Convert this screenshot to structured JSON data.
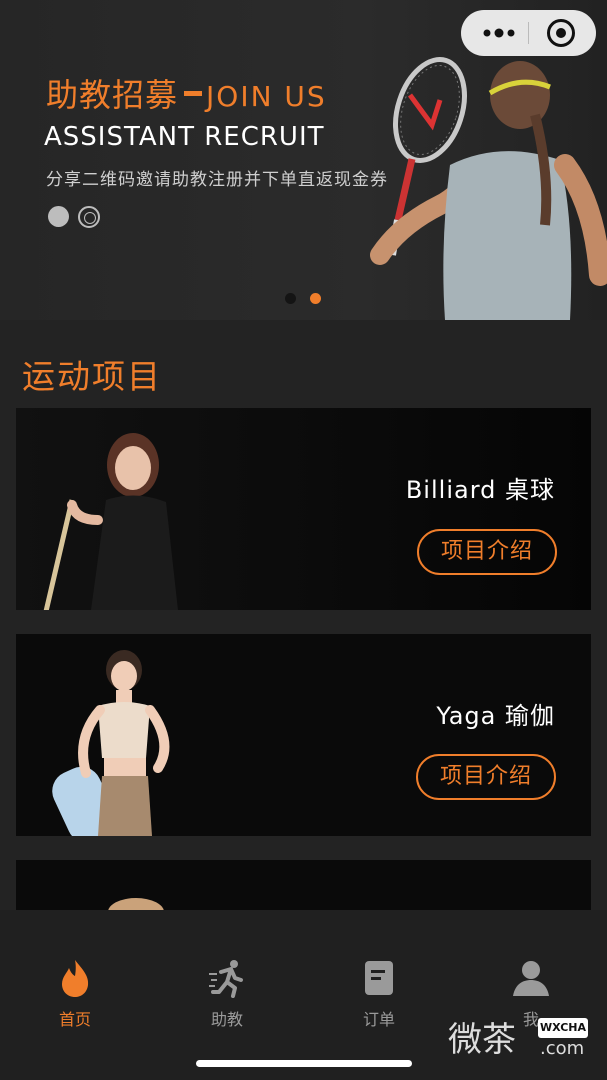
{
  "banner": {
    "title_cn": "助教招募",
    "title_en": "JOIN US",
    "subtitle": "ASSISTANT RECRUIT",
    "description": "分享二维码邀请助教注册并下单直返现金券"
  },
  "section": {
    "title": "运动项目"
  },
  "cards": [
    {
      "name": "Billiard 桌球",
      "button": "项目介绍"
    },
    {
      "name": "Yaga 瑜伽",
      "button": "项目介绍"
    }
  ],
  "tabs": [
    {
      "label": "首页",
      "icon": "flame-icon",
      "active": true
    },
    {
      "label": "助教",
      "icon": "runner-icon",
      "active": false
    },
    {
      "label": "订单",
      "icon": "document-icon",
      "active": false
    },
    {
      "label": "我",
      "icon": "user-icon",
      "active": false
    }
  ],
  "watermark": {
    "text": "微茶",
    "badge": "WXCHA",
    "domain": ".com"
  },
  "colors": {
    "accent": "#f07e2b",
    "background": "#232323",
    "card": "#0a0a0a"
  }
}
